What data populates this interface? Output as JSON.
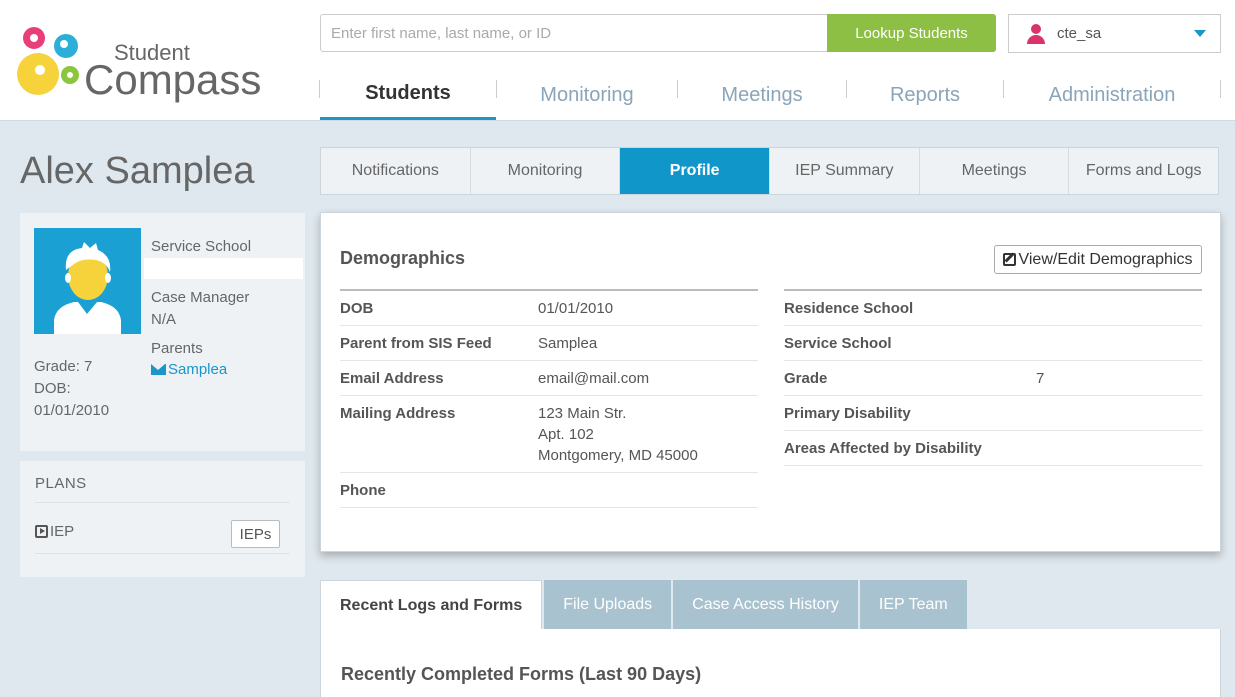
{
  "header": {
    "logo": {
      "line1": "Student",
      "line2": "Compass"
    },
    "search": {
      "placeholder": "Enter first name, last name, or ID",
      "value": ""
    },
    "lookup_label": "Lookup Students",
    "user": {
      "name": "cte_sa"
    },
    "nav": [
      "Students",
      "Monitoring",
      "Meetings",
      "Reports",
      "Administration"
    ],
    "nav_active": "Students"
  },
  "student": {
    "name": "Alex Samplea",
    "service_school_label": "Service School",
    "service_school_value": "",
    "case_manager_label": "Case Manager",
    "case_manager_value": "N/A",
    "parents_label": "Parents",
    "parent_name": "Samplea",
    "grade": "Grade: 7",
    "dob_label": "DOB:",
    "dob_value": "01/01/2010"
  },
  "plans": {
    "title": "PLANS",
    "item_label": "IEP",
    "button_label": "IEPs"
  },
  "sub_tabs": [
    "Notifications",
    "Monitoring",
    "Profile",
    "IEP Summary",
    "Meetings",
    "Forms and Logs"
  ],
  "sub_tab_active": "Profile",
  "demographics": {
    "title": "Demographics",
    "edit_label": "View/Edit Demographics",
    "left_rows": [
      {
        "label": "DOB",
        "value": "01/01/2010"
      },
      {
        "label": "Parent from SIS Feed",
        "value": "Samplea"
      },
      {
        "label": "Email Address",
        "value": "email@mail.com"
      },
      {
        "label": "Mailing Address",
        "value_lines": [
          "123 Main Str.",
          "Apt. 102",
          "Montgomery, MD 45000"
        ]
      },
      {
        "label": "Phone",
        "value": ""
      }
    ],
    "right_rows": [
      {
        "label": "Residence School",
        "value": ""
      },
      {
        "label": "Service School",
        "value": ""
      },
      {
        "label": "Grade",
        "value": "7"
      },
      {
        "label": "Primary Disability",
        "value": ""
      },
      {
        "label": "Areas Affected by Disability",
        "value": ""
      }
    ]
  },
  "lower_tabs": [
    "Recent Logs and Forms",
    "File Uploads",
    "Case Access History",
    "IEP Team"
  ],
  "lower_tab_active": "Recent Logs and Forms",
  "recent_forms_title": "Recently Completed Forms (Last 90 Days)",
  "colors": {
    "accent": "#1196c9",
    "lookup_green": "#8dbf44",
    "user_pink": "#d9336a",
    "inactive_tab": "#a9c2cf"
  }
}
